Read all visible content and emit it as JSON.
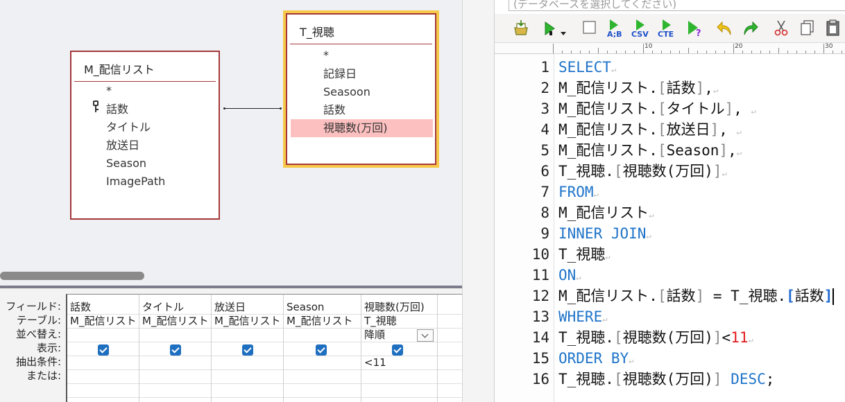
{
  "designer": {
    "tables": {
      "m_list": {
        "title": "M_配信リスト",
        "fields": [
          "*",
          "話数",
          "タイトル",
          "放送日",
          "Season",
          "ImagePath"
        ]
      },
      "t_view": {
        "title": "T_視聴",
        "fields": [
          "*",
          "記録日",
          "Seasoon",
          "話数",
          "視聴数(万回)"
        ]
      }
    },
    "grid": {
      "row_labels": [
        "フィールド:",
        "テーブル:",
        "並べ替え:",
        "表示:",
        "抽出条件:",
        "または:"
      ],
      "columns": [
        {
          "field": "話数",
          "table": "M_配信リスト",
          "sort": "",
          "show": true,
          "criteria": ""
        },
        {
          "field": "タイトル",
          "table": "M_配信リスト",
          "sort": "",
          "show": true,
          "criteria": ""
        },
        {
          "field": "放送日",
          "table": "M_配信リスト",
          "sort": "",
          "show": true,
          "criteria": ""
        },
        {
          "field": "Season",
          "table": "M_配信リスト",
          "sort": "",
          "show": true,
          "criteria": ""
        },
        {
          "field": "視聴数(万回)",
          "table": "T_視聴",
          "sort": "降順",
          "show": true,
          "criteria": "<11"
        }
      ]
    }
  },
  "editor": {
    "db_combo_placeholder": "(データベースを選択してください)",
    "toolbar": {
      "ab_label": "A;B",
      "csv_label": "CSV",
      "cte_label": "CTE",
      "q_label": "?"
    },
    "ruler": [
      "10",
      "20",
      "30"
    ],
    "code_lines": [
      {
        "n": "1",
        "parts": [
          {
            "t": "SELECT",
            "c": "kw"
          }
        ]
      },
      {
        "n": "2",
        "parts": [
          {
            "t": "M_配信リスト."
          },
          {
            "t": "[",
            "c": "br"
          },
          {
            "t": "話数"
          },
          {
            "t": "]",
            "c": "br"
          },
          {
            "t": ","
          }
        ]
      },
      {
        "n": "3",
        "parts": [
          {
            "t": "M_配信リスト."
          },
          {
            "t": "[",
            "c": "br"
          },
          {
            "t": "タイトル"
          },
          {
            "t": "]",
            "c": "br"
          },
          {
            "t": ", "
          }
        ]
      },
      {
        "n": "4",
        "parts": [
          {
            "t": "M_配信リスト."
          },
          {
            "t": "[",
            "c": "br"
          },
          {
            "t": "放送日"
          },
          {
            "t": "]",
            "c": "br"
          },
          {
            "t": ", "
          }
        ]
      },
      {
        "n": "5",
        "parts": [
          {
            "t": "M_配信リスト."
          },
          {
            "t": "[",
            "c": "br"
          },
          {
            "t": "Season"
          },
          {
            "t": "]",
            "c": "br"
          },
          {
            "t": ","
          }
        ]
      },
      {
        "n": "6",
        "parts": [
          {
            "t": "T_視聴."
          },
          {
            "t": "[",
            "c": "br"
          },
          {
            "t": "視聴数(万回)"
          },
          {
            "t": "]",
            "c": "br"
          }
        ]
      },
      {
        "n": "7",
        "parts": [
          {
            "t": "FROM",
            "c": "kw"
          }
        ]
      },
      {
        "n": "8",
        "parts": [
          {
            "t": "M_配信リスト"
          }
        ]
      },
      {
        "n": "9",
        "parts": [
          {
            "t": "INNER JOIN",
            "c": "kw"
          }
        ]
      },
      {
        "n": "10",
        "parts": [
          {
            "t": "T_視聴"
          }
        ]
      },
      {
        "n": "11",
        "parts": [
          {
            "t": "ON",
            "c": "kw"
          }
        ]
      },
      {
        "n": "12",
        "parts": [
          {
            "t": "M_配信リスト."
          },
          {
            "t": "[",
            "c": "br"
          },
          {
            "t": "話数"
          },
          {
            "t": "]",
            "c": "br"
          },
          {
            "t": " = T_視聴."
          },
          {
            "t": "[",
            "c": "brh"
          },
          {
            "t": "話数"
          },
          {
            "t": "]",
            "c": "brh"
          }
        ],
        "cursor": true,
        "nomark": true
      },
      {
        "n": "13",
        "parts": [
          {
            "t": "WHERE",
            "c": "kw"
          }
        ]
      },
      {
        "n": "14",
        "parts": [
          {
            "t": "T_視聴."
          },
          {
            "t": "[",
            "c": "br"
          },
          {
            "t": "視聴数(万回)"
          },
          {
            "t": "]",
            "c": "br"
          },
          {
            "t": "<"
          },
          {
            "t": "11",
            "c": "num"
          }
        ]
      },
      {
        "n": "15",
        "parts": [
          {
            "t": "ORDER BY",
            "c": "kw"
          }
        ]
      },
      {
        "n": "16",
        "parts": [
          {
            "t": "T_視聴."
          },
          {
            "t": "[",
            "c": "br"
          },
          {
            "t": "視聴数(万回)"
          },
          {
            "t": "]",
            "c": "br"
          },
          {
            "t": " "
          },
          {
            "t": "DESC",
            "c": "kw"
          },
          {
            "t": ";"
          }
        ],
        "nomark": true
      }
    ],
    "newline_mark": "↵"
  },
  "colors": {
    "keyword": "#1e73c9",
    "number": "#e21a1a",
    "table_border": "#a4373a",
    "selected_table_outline": "#f7c94a",
    "selected_field_bg": "#fdc0c0",
    "checkbox": "#1f6fc0"
  }
}
